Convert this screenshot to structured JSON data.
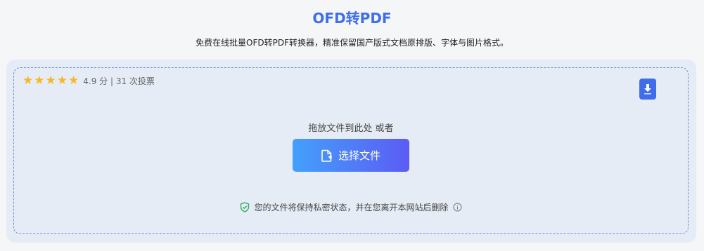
{
  "page": {
    "title": "OFD转PDF",
    "subtitle": "免费在线批量OFD转PDF转换器，精准保留国产版式文档原排版、字体与图片格式。"
  },
  "rating": {
    "stars": 5,
    "text": "4.9 分 | 31 次投票"
  },
  "dropzone": {
    "drop_text": "拖放文件到此处 或者",
    "choose_label": "选择文件",
    "privacy_text": "您的文件将保持私密状态，并在您离开本网站后删除"
  },
  "colors": {
    "accent": "#3f6ee8",
    "star": "#f7b728",
    "shield": "#2fae5a",
    "button_gradient_start": "#44a0fb",
    "button_gradient_end": "#5b5cf4"
  },
  "icons": {
    "download": "download-icon",
    "file": "file-plus-icon",
    "shield": "shield-check-icon",
    "info": "info-icon"
  }
}
